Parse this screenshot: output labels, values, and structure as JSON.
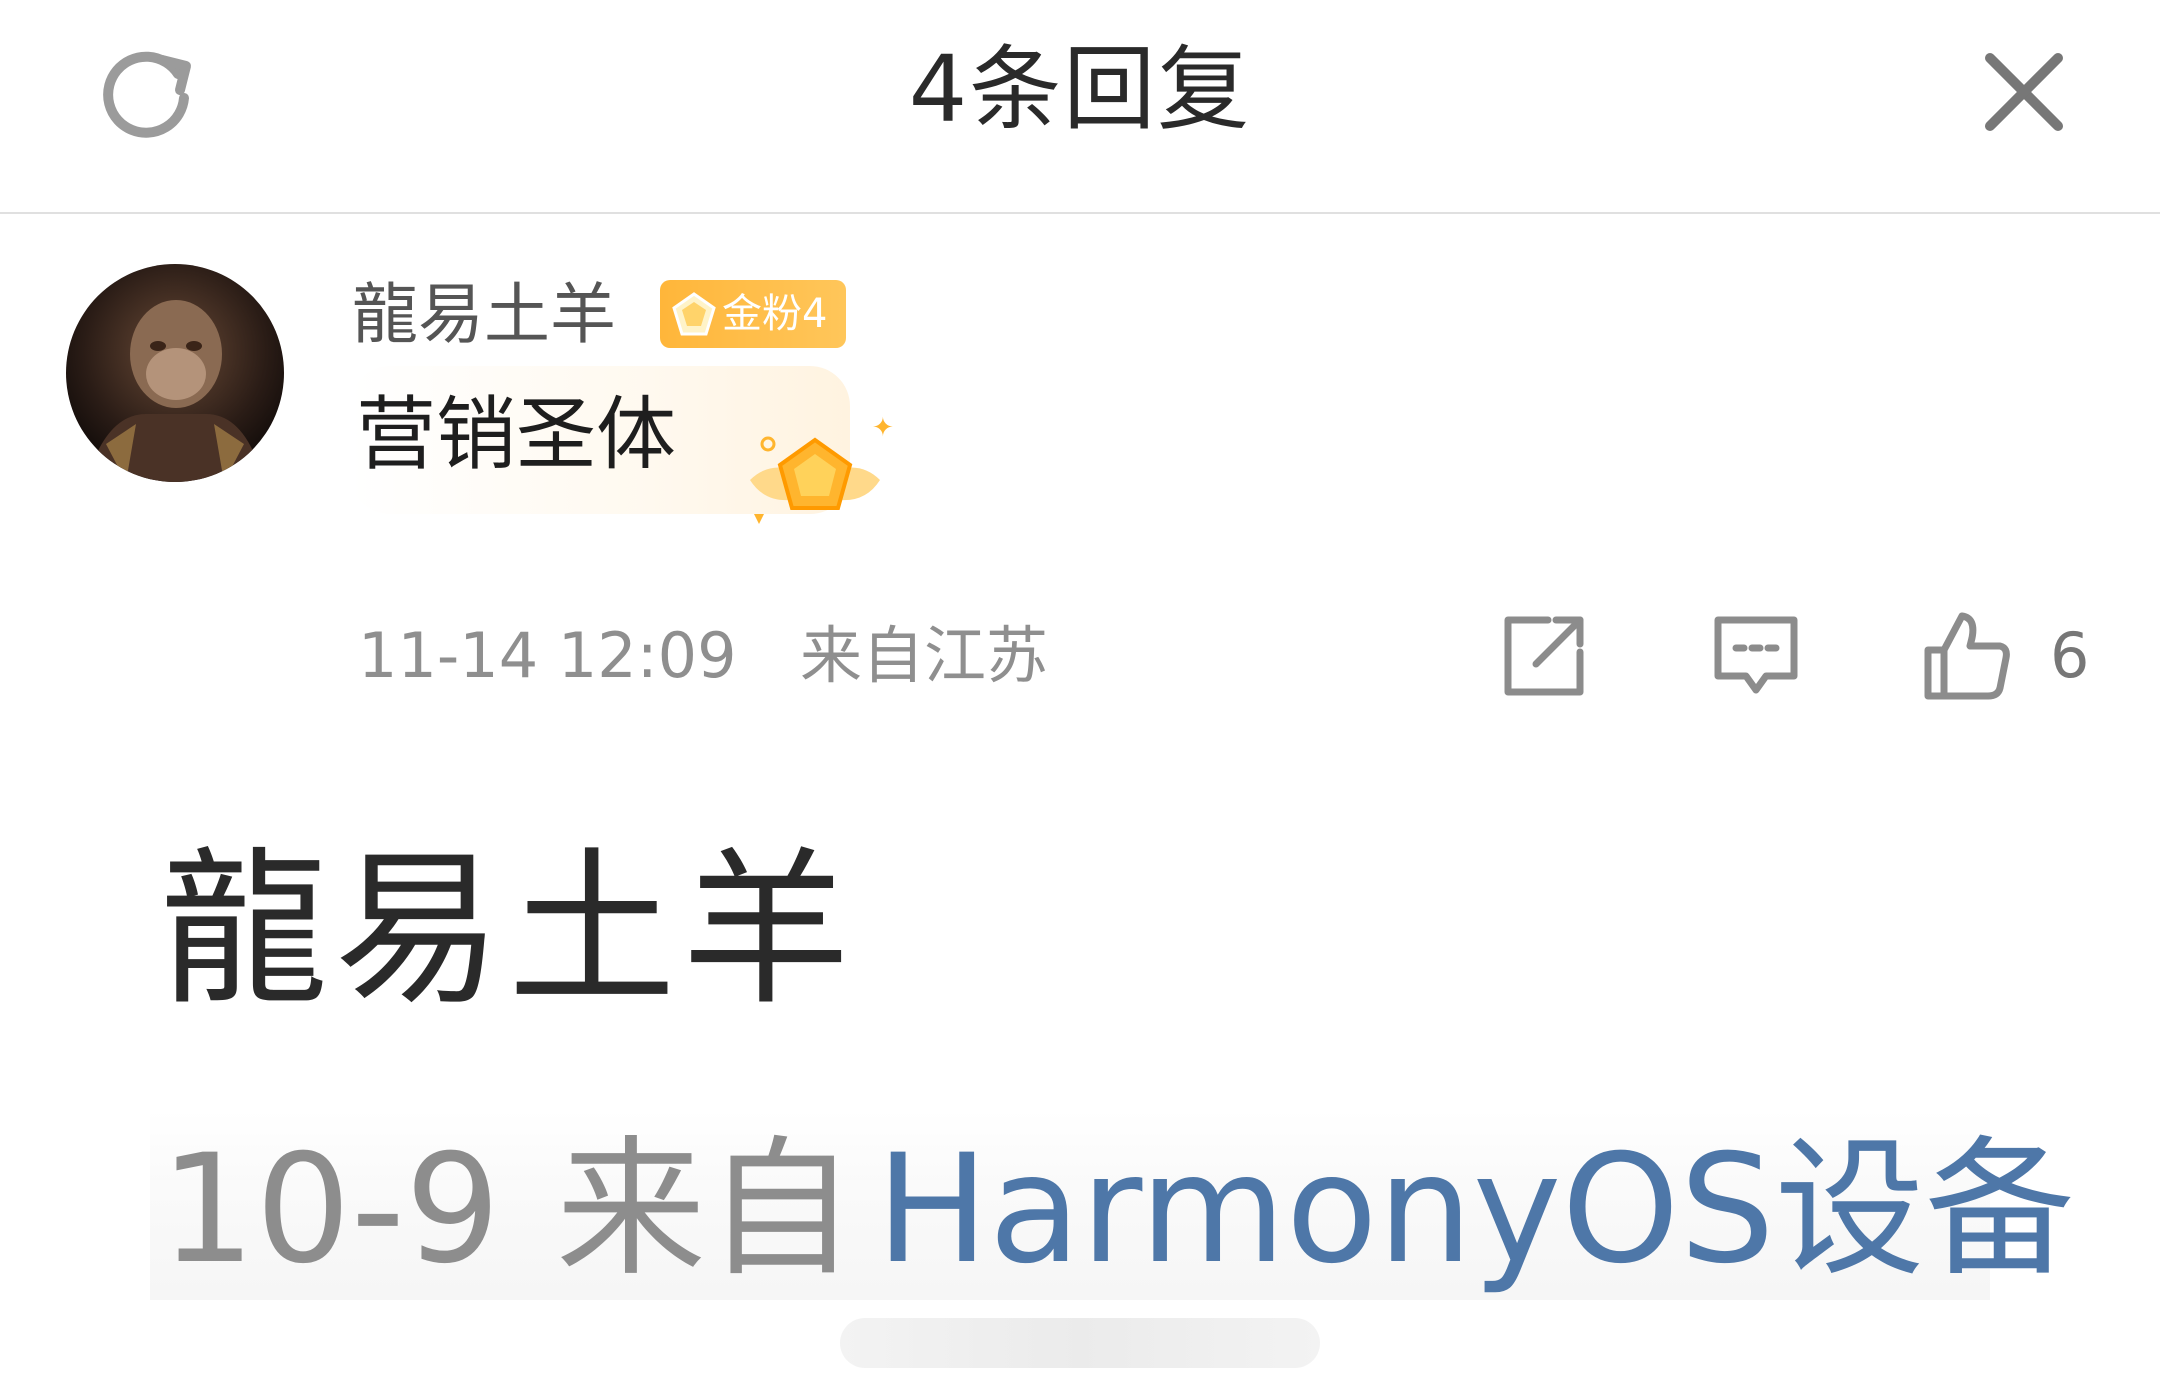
{
  "header": {
    "title": "4条回复",
    "refresh_icon": "refresh-icon",
    "close_icon": "close-icon"
  },
  "comment": {
    "avatar": "avatar-monkey-king",
    "username": "龍易土羊",
    "badge": {
      "label": "金粉4",
      "icon": "gem-icon",
      "color": "#ffb63a"
    },
    "text": "营销圣体",
    "bubble_decoration": "gold-gem-wings-icon",
    "timestamp": "11-14 12:09",
    "location": "来自江苏",
    "actions": {
      "share_icon": "share-icon",
      "reply_icon": "reply-icon",
      "like_icon": "like-icon",
      "like_count": "6"
    }
  },
  "overlay": {
    "name": "龍易土羊",
    "date": "10-9",
    "from": "来自",
    "device": "HarmonyOS设备",
    "device_color": "#4e77a8"
  }
}
